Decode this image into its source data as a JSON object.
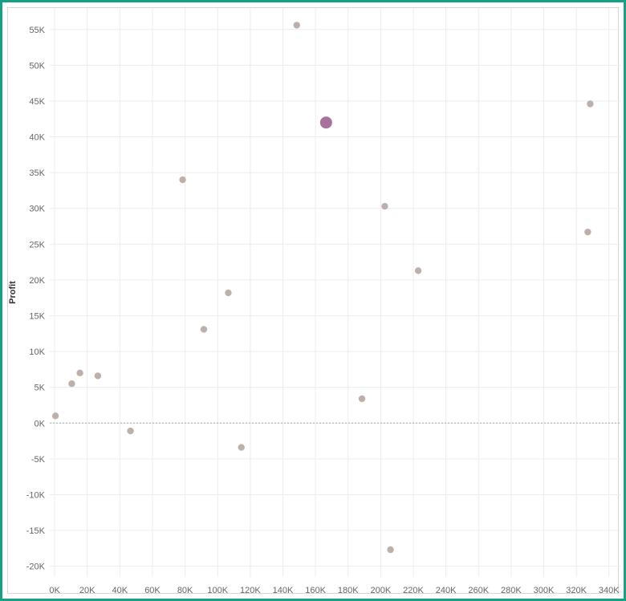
{
  "chart_data": {
    "type": "scatter",
    "title": "",
    "xlabel": "",
    "ylabel": "Profit",
    "xlim": [
      -3000,
      347000
    ],
    "ylim": [
      -21500,
      58000
    ],
    "x_ticks": [
      0,
      20000,
      40000,
      60000,
      80000,
      100000,
      120000,
      140000,
      160000,
      180000,
      200000,
      220000,
      240000,
      260000,
      280000,
      300000,
      320000,
      340000
    ],
    "x_tick_labels": [
      "0K",
      "20K",
      "40K",
      "60K",
      "80K",
      "100K",
      "120K",
      "140K",
      "160K",
      "180K",
      "200K",
      "220K",
      "240K",
      "260K",
      "280K",
      "300K",
      "320K",
      "340K"
    ],
    "y_ticks": [
      -20000,
      -15000,
      -10000,
      -5000,
      0,
      5000,
      10000,
      15000,
      20000,
      25000,
      30000,
      35000,
      40000,
      45000,
      50000,
      55000
    ],
    "y_tick_labels": [
      "-20K",
      "-15K",
      "-10K",
      "-5K",
      "0K",
      "5K",
      "10K",
      "15K",
      "20K",
      "25K",
      "30K",
      "35K",
      "40K",
      "45K",
      "50K",
      "55K"
    ],
    "grid": true,
    "zero_line": true,
    "colors": {
      "point": "#bdb0ab",
      "highlight": "#a8729c",
      "grid": "#ececec",
      "zero_line": "#aaaaaa",
      "frame": "#16a085"
    },
    "series": [
      {
        "points": [
          {
            "x": 500,
            "y": 1000
          },
          {
            "x": 10500,
            "y": 5500
          },
          {
            "x": 15500,
            "y": 7000
          },
          {
            "x": 26500,
            "y": 6600
          },
          {
            "x": 46500,
            "y": -1100
          },
          {
            "x": 78500,
            "y": 34000
          },
          {
            "x": 91500,
            "y": 13100
          },
          {
            "x": 106500,
            "y": 18200
          },
          {
            "x": 114500,
            "y": -3400
          },
          {
            "x": 148500,
            "y": 55600
          },
          {
            "x": 166500,
            "y": 42000,
            "highlight": true
          },
          {
            "x": 188500,
            "y": 3400
          },
          {
            "x": 202500,
            "y": 30300
          },
          {
            "x": 206000,
            "y": -17700
          },
          {
            "x": 223000,
            "y": 21300
          },
          {
            "x": 327000,
            "y": 26700
          },
          {
            "x": 328500,
            "y": 44600
          }
        ]
      }
    ]
  }
}
